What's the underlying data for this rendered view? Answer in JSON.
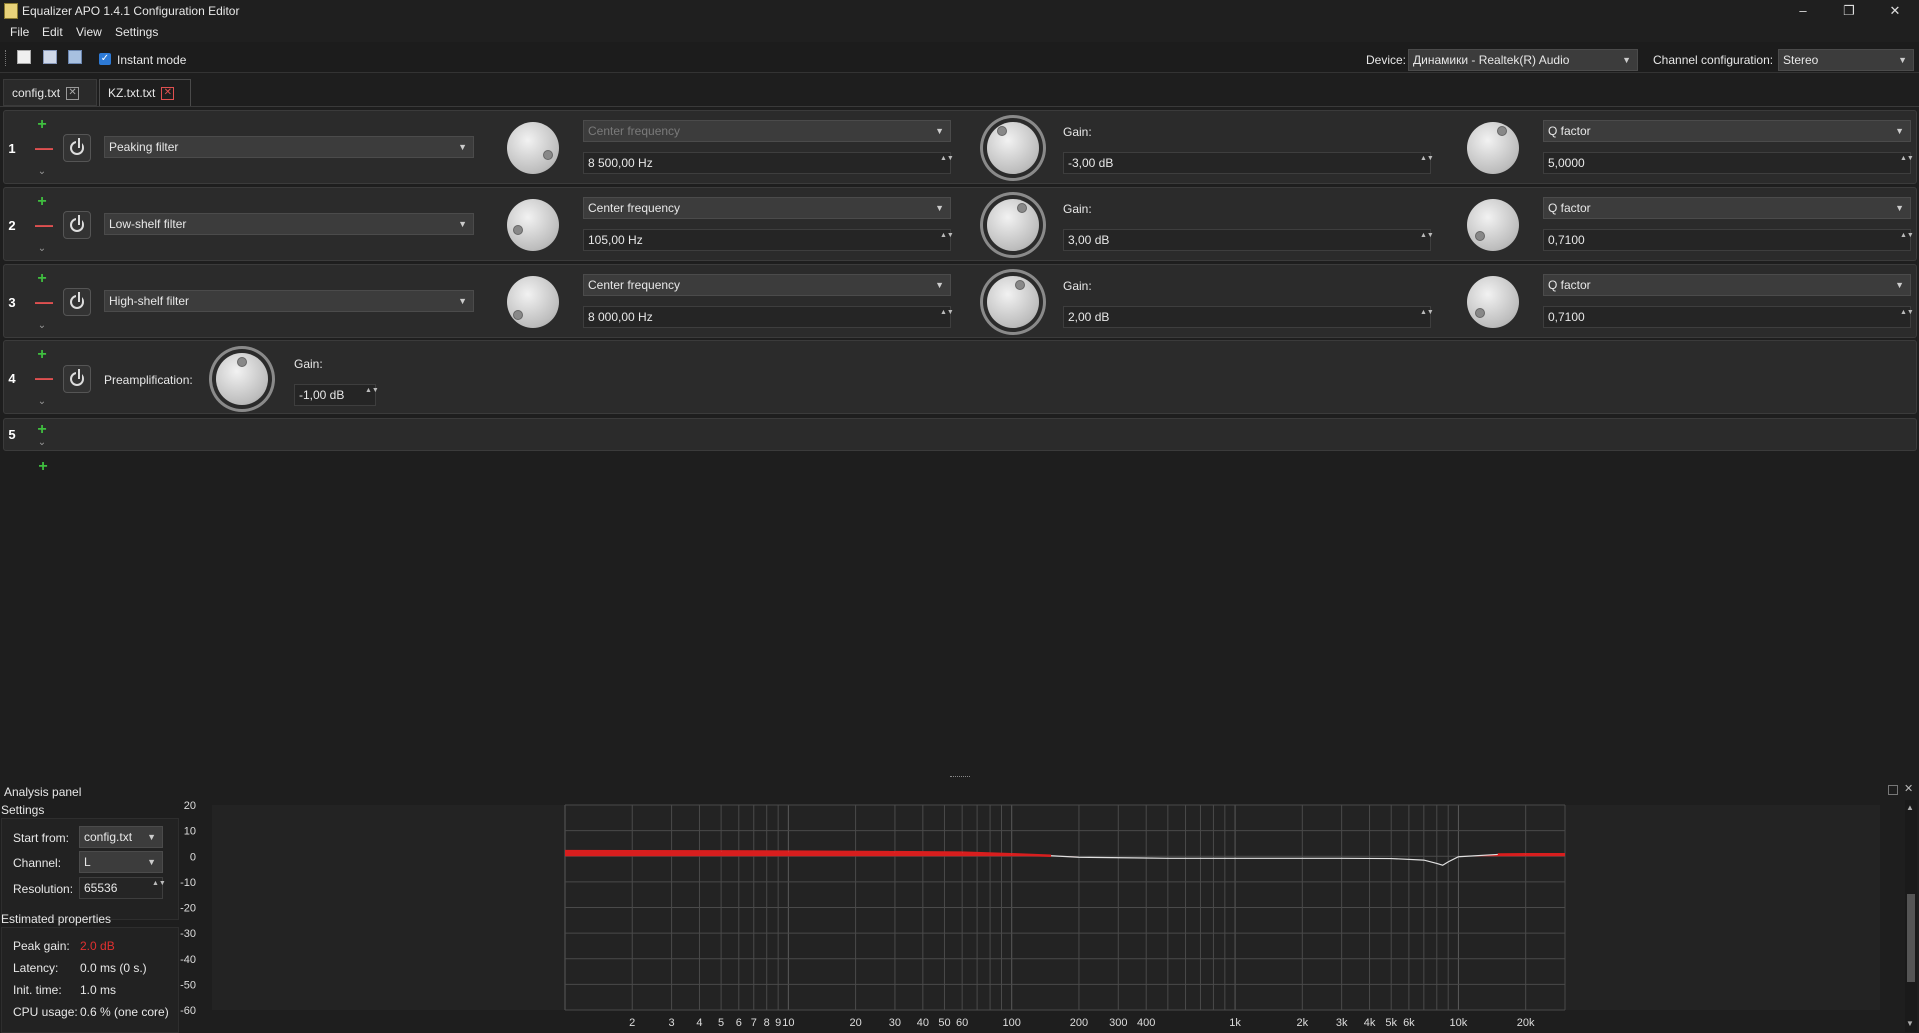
{
  "window": {
    "title": "Equalizer APO 1.4.1 Configuration Editor",
    "minimize": "–",
    "maximize": "❐",
    "close": "✕"
  },
  "menu": [
    "File",
    "Edit",
    "View",
    "Settings"
  ],
  "toolbar": {
    "instant_mode": "Instant mode",
    "instant_checked": "✓",
    "device_label": "Device:",
    "device_value": "Динамики - Realtek(R) Audio",
    "channel_label": "Channel configuration:",
    "channel_value": "Stereo"
  },
  "tabs": [
    {
      "label": "config.txt",
      "close": "✕"
    },
    {
      "label": "KZ.txt.txt",
      "close": "✕"
    }
  ],
  "filters": [
    {
      "num": "1",
      "type": "Peaking filter",
      "freq_mode": "Center frequency",
      "freq_value": "8 500,00 Hz",
      "gain_label": "Gain:",
      "gain_value": "-3,00 dB",
      "q_mode": "Q factor",
      "q_value": "5,0000"
    },
    {
      "num": "2",
      "type": "Low-shelf filter",
      "freq_mode": "Center frequency",
      "freq_value": "105,00 Hz",
      "gain_label": "Gain:",
      "gain_value": "3,00 dB",
      "q_mode": "Q factor",
      "q_value": "0,7100"
    },
    {
      "num": "3",
      "type": "High-shelf filter",
      "freq_mode": "Center frequency",
      "freq_value": "8 000,00 Hz",
      "gain_label": "Gain:",
      "gain_value": "2,00 dB",
      "q_mode": "Q factor",
      "q_value": "0,7100"
    }
  ],
  "preamp": {
    "num": "4",
    "label": "Preamplification:",
    "gain_label": "Gain:",
    "gain_value": "-1,00 dB"
  },
  "empty_row": {
    "num": "5"
  },
  "glyphs": {
    "plus": "+",
    "minus": "—",
    "chevron": "⌄",
    "arrow": "▼",
    "spin": "▲▼"
  },
  "analysis": {
    "title": "Analysis panel",
    "settings_label": "Settings",
    "start_from_label": "Start from:",
    "start_from_value": "config.txt",
    "channel_label": "Channel:",
    "channel_value": "L",
    "resolution_label": "Resolution:",
    "resolution_value": "65536",
    "estimated_label": "Estimated properties",
    "peak_gain_label": "Peak gain:",
    "peak_gain_value": "2.0 dB",
    "latency_label": "Latency:",
    "latency_value": "0.0 ms (0 s.)",
    "init_time_label": "Init. time:",
    "init_time_value": "1.0 ms",
    "cpu_label": "CPU usage:",
    "cpu_value": "0.6 % (one core)"
  },
  "colors": {
    "peak_gain": "#e03030",
    "curve_positive": "#d81e1e",
    "curve_neutral": "#e0e0e0",
    "grid": "#4a4a4a",
    "plot_bg": "#232323"
  },
  "chart_data": {
    "type": "line",
    "x_scale": "log",
    "xlim": [
      1,
      30000
    ],
    "ylim": [
      -60,
      20
    ],
    "y_ticks": [
      "20",
      "10",
      "0",
      "-10",
      "-20",
      "-30",
      "-40",
      "-50",
      "-60"
    ],
    "x_ticks": [
      {
        "v": 2,
        "t": "2"
      },
      {
        "v": 3,
        "t": "3"
      },
      {
        "v": 4,
        "t": "4"
      },
      {
        "v": 5,
        "t": "5"
      },
      {
        "v": 6,
        "t": "6"
      },
      {
        "v": 7,
        "t": "7"
      },
      {
        "v": 8,
        "t": "8"
      },
      {
        "v": 9,
        "t": "9"
      },
      {
        "v": 10,
        "t": "10"
      },
      {
        "v": 20,
        "t": "20"
      },
      {
        "v": 30,
        "t": "30"
      },
      {
        "v": 40,
        "t": "40"
      },
      {
        "v": 50,
        "t": "50"
      },
      {
        "v": 60,
        "t": "60"
      },
      {
        "v": 100,
        "t": "100"
      },
      {
        "v": 200,
        "t": "200"
      },
      {
        "v": 300,
        "t": "300"
      },
      {
        "v": 400,
        "t": "400"
      },
      {
        "v": 1000,
        "t": "1k"
      },
      {
        "v": 2000,
        "t": "2k"
      },
      {
        "v": 3000,
        "t": "3k"
      },
      {
        "v": 4000,
        "t": "4k"
      },
      {
        "v": 5000,
        "t": "5k"
      },
      {
        "v": 6000,
        "t": "6k"
      },
      {
        "v": 10000,
        "t": "10k"
      },
      {
        "v": 20000,
        "t": "20k"
      }
    ],
    "grid": true,
    "series": [
      {
        "x": [
          1,
          5,
          10,
          30,
          60,
          100,
          150,
          200,
          500,
          1000,
          3000,
          5000,
          7000,
          8000,
          8500,
          9000,
          10000,
          15000,
          20000,
          30000
        ],
        "y": [
          2.0,
          1.9,
          1.8,
          1.6,
          1.4,
          0.8,
          0.2,
          -0.4,
          -0.8,
          -0.8,
          -0.8,
          -0.9,
          -1.5,
          -2.8,
          -3.5,
          -2.2,
          -0.2,
          0.7,
          0.8,
          0.8
        ]
      }
    ]
  }
}
